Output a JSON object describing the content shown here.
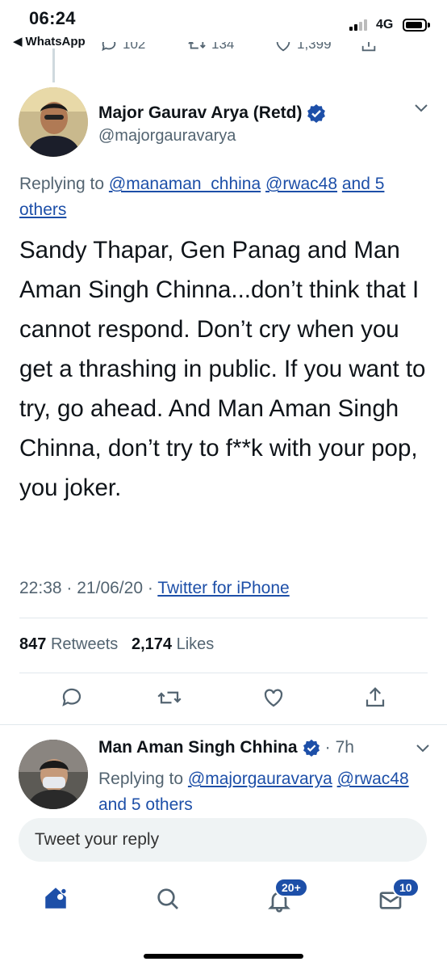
{
  "status": {
    "time": "06:24",
    "back_app": "WhatsApp",
    "network": "4G"
  },
  "prev_tweet": {
    "replies": "102",
    "retweets": "134",
    "likes": "1,399"
  },
  "tweet": {
    "author_name": "Major Gaurav Arya (Retd)",
    "author_handle": "@majorgauravarya",
    "replying_label": "Replying to",
    "replying_to_1": "@manaman_chhina",
    "replying_to_2": "@rwac48",
    "replying_others": "and 5 others",
    "text": "Sandy Thapar, Gen Panag and Man Aman Singh Chinna...don’t think that I cannot respond. Don’t cry when you get a thrashing in public. If you want to try, go ahead. And Man Aman Singh Chinna, don’t try to f**k with your pop, you joker.",
    "time": "22:38",
    "date": "21/06/20",
    "source": "Twitter for iPhone",
    "retweets_count": "847",
    "retweets_label": "Retweets",
    "likes_count": "2,174",
    "likes_label": "Likes"
  },
  "reply": {
    "author_name": "Man Aman Singh Chhina",
    "age": "7h",
    "replying_label": "Replying to",
    "replying_to_1": "@majorgauravarya",
    "replying_to_2": "@rwac48",
    "replying_others": "and 5 others"
  },
  "compose": {
    "placeholder": "Tweet your reply"
  },
  "tabbar": {
    "notifications_badge": "20+",
    "messages_badge": "10"
  },
  "colors": {
    "accent": "#1d4fa8",
    "secondary_text": "#536471",
    "verified": "#1d4fa8"
  }
}
